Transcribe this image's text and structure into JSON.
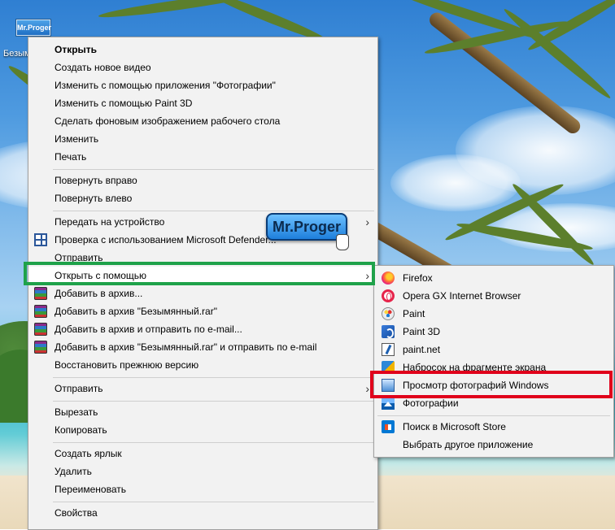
{
  "desktop": {
    "icon_thumb_text": "Mr.Proger",
    "icon_label": "Безымянный"
  },
  "watermark": "Mr.Proger",
  "main_menu": {
    "items": [
      {
        "label": "Открыть",
        "bold": true
      },
      {
        "label": "Создать новое видео"
      },
      {
        "label": "Изменить с помощью приложения \"Фотографии\""
      },
      {
        "label": "Изменить с помощью Paint 3D"
      },
      {
        "label": "Сделать фоновым изображением рабочего стола"
      },
      {
        "label": "Изменить"
      },
      {
        "label": "Печать"
      },
      {
        "label": "Повернуть вправо"
      },
      {
        "label": "Повернуть влево"
      },
      {
        "label": "Передать на устройство",
        "submenu": true
      },
      {
        "label": "Проверка с использованием Microsoft Defender...",
        "icon": "defender-icon"
      },
      {
        "label": "Отправить"
      },
      {
        "label": "Открыть с помощью",
        "submenu": true
      },
      {
        "label": "Добавить в архив...",
        "icon": "winrar-icon"
      },
      {
        "label": "Добавить в архив \"Безымянный.rar\"",
        "icon": "winrar-icon"
      },
      {
        "label": "Добавить в архив и отправить по e-mail...",
        "icon": "winrar-icon"
      },
      {
        "label": "Добавить в архив \"Безымянный.rar\" и отправить по e-mail",
        "icon": "winrar-icon"
      },
      {
        "label": "Восстановить прежнюю версию"
      },
      {
        "label": "Отправить",
        "submenu": true
      },
      {
        "label": "Вырезать"
      },
      {
        "label": "Копировать"
      },
      {
        "label": "Создать ярлык"
      },
      {
        "label": "Удалить"
      },
      {
        "label": "Переименовать"
      },
      {
        "label": "Свойства"
      }
    ],
    "submenu_arrow": "›"
  },
  "open_with_menu": {
    "items": [
      {
        "label": "Firefox",
        "icon": "firefox-icon"
      },
      {
        "label": "Opera GX Internet Browser",
        "icon": "opera-icon"
      },
      {
        "label": "Paint",
        "icon": "paint-icon"
      },
      {
        "label": "Paint 3D",
        "icon": "paint-3d-icon"
      },
      {
        "label": "paint.net",
        "icon": "paint-net-icon"
      },
      {
        "label": "Набросок на фрагменте экрана",
        "icon": "snip-sketch-icon"
      },
      {
        "label": "Просмотр фотографий Windows",
        "icon": "photo-viewer-icon"
      },
      {
        "label": "Фотографии",
        "icon": "photos-icon"
      },
      {
        "label": "Поиск в Microsoft Store",
        "icon": "store-icon"
      },
      {
        "label": "Выбрать другое приложение"
      }
    ]
  },
  "colors": {
    "highlight_green": "#1fa24a",
    "highlight_red": "#e0001b",
    "menu_background": "#f2f2f2"
  }
}
